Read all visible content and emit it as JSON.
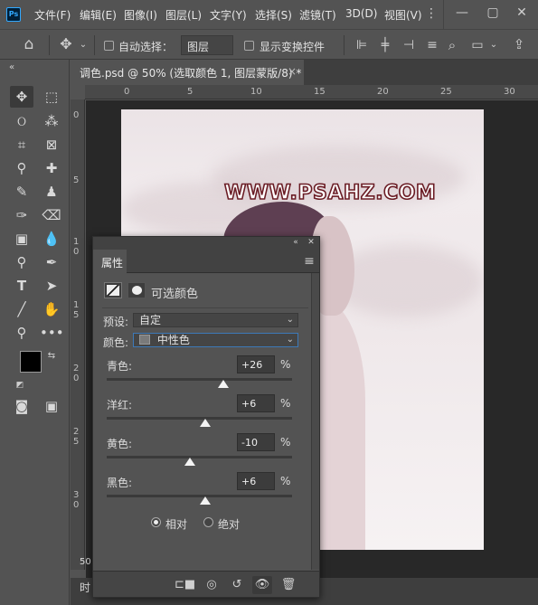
{
  "app": {
    "logo_text": "Ps"
  },
  "menu": [
    "文件(F)",
    "编辑(E)",
    "图像(I)",
    "图层(L)",
    "文字(Y)",
    "选择(S)",
    "滤镜(T)",
    "3D(D)",
    "视图(V)"
  ],
  "options_bar": {
    "auto_select_label": "自动选择：",
    "auto_select_target": "图层",
    "show_transform_label": "显示变换控件"
  },
  "document": {
    "tab_title": "调色.psd @ 50% (选取颜色 1, 图层蒙版/8) *",
    "close_glyph": "×",
    "watermark": "WWW.PSAHZ.COM",
    "zoom": "50",
    "status_text": "时"
  },
  "rulers": {
    "top": [
      "0",
      "5",
      "10",
      "15",
      "20",
      "25",
      "30"
    ],
    "left": [
      "0",
      "5",
      "1\n0",
      "1\n5",
      "2\n0",
      "2\n5",
      "3\n0"
    ]
  },
  "panel": {
    "tab": "属性",
    "title": "可选颜色",
    "preset_label": "预设:",
    "preset_value": "自定",
    "color_label": "颜色:",
    "color_value": "中性色",
    "color_swatch": "#7a7a7a",
    "sliders": [
      {
        "label": "青色:",
        "value": "+26",
        "unit": "%",
        "level": 26
      },
      {
        "label": "洋红:",
        "value": "+6",
        "unit": "%",
        "level": 6
      },
      {
        "label": "黄色:",
        "value": "-10",
        "unit": "%",
        "level": -10
      },
      {
        "label": "黑色:",
        "value": "+6",
        "unit": "%",
        "level": 6
      }
    ],
    "method_relative": "相对",
    "method_absolute": "绝对",
    "method_selected": "relative"
  },
  "colors": {
    "foreground": "#000000",
    "background": "#ffffff",
    "accent": "#31a8ff"
  }
}
